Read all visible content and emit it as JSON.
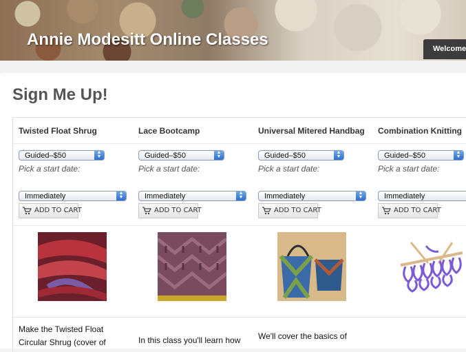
{
  "site": {
    "title": "Annie Modesitt Online Classes",
    "welcome": "Welcome"
  },
  "page": {
    "title": "Sign Me Up!"
  },
  "cart_label": "ADD TO CART",
  "classes": [
    {
      "title": "Twisted Float Shrug",
      "price_option": "Guided–$50",
      "prompt": "Pick a start date:",
      "start_option": "Immediately",
      "desc_1": "Make the Twisted Float",
      "desc_2": "Circular Shrug (cover of"
    },
    {
      "title": "Lace Bootcamp",
      "price_option": "Guided–$50",
      "prompt": "Pick a start date:",
      "start_option": "Immediately",
      "desc_1": "In this class you'll learn how"
    },
    {
      "title": "Universal Mitered Handbag",
      "price_option": "Guided–$50",
      "prompt": "Pick a start date:",
      "start_option": "Immediately",
      "desc_1": "We'll cover the basics of"
    },
    {
      "title": "Combination Knitting",
      "price_option": "Guided–$50",
      "prompt": "Pick a start date:",
      "start_option": "Immediately"
    }
  ]
}
